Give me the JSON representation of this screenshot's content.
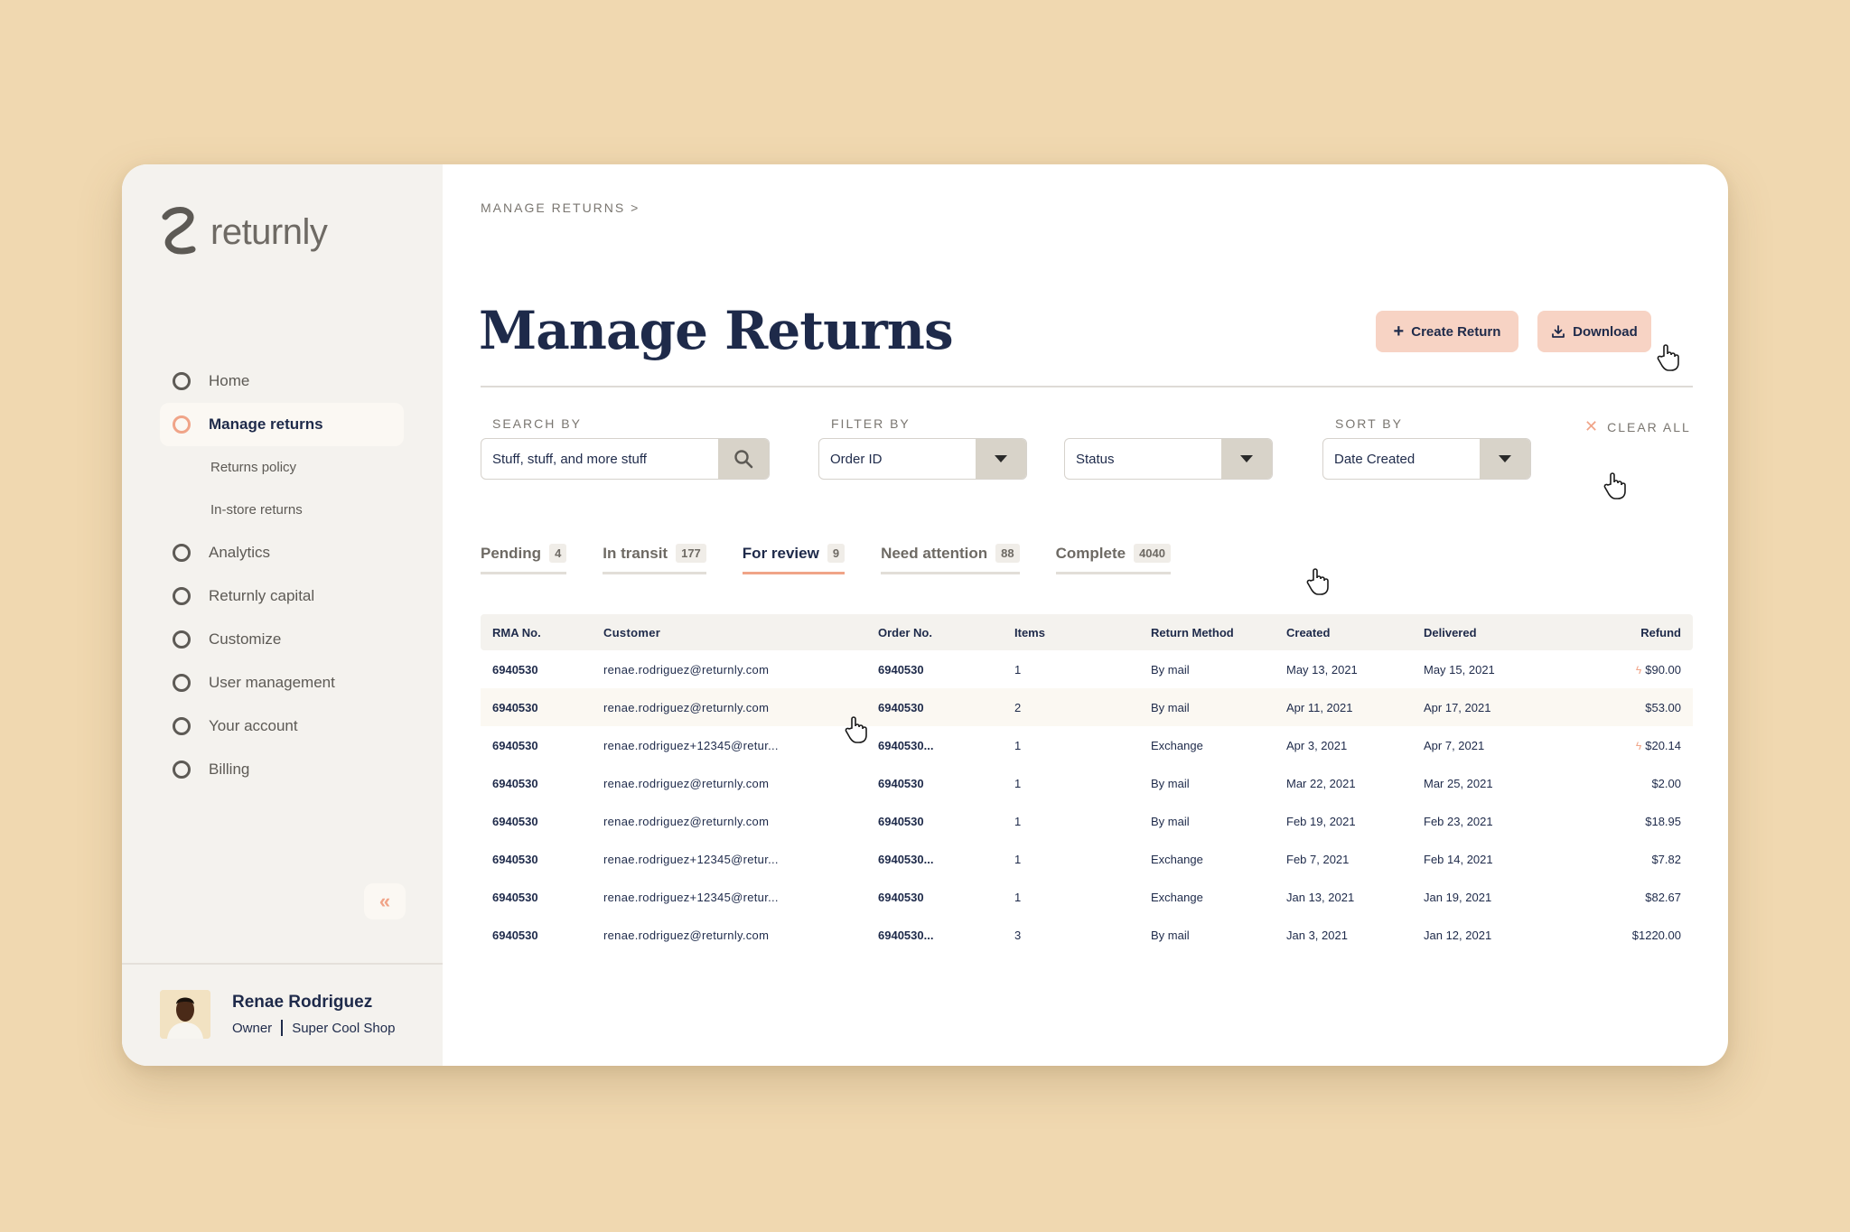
{
  "brand": {
    "name": "returnly",
    "accent": "#f0a488",
    "navy": "#1e2a4a"
  },
  "sidebar": {
    "nav": [
      {
        "label": "Home",
        "active": false
      },
      {
        "label": "Manage returns",
        "active": true
      },
      {
        "label": "Returns policy",
        "sub": true
      },
      {
        "label": "In-store returns",
        "sub": true
      },
      {
        "label": "Analytics",
        "active": false
      },
      {
        "label": "Returnly capital",
        "active": false
      },
      {
        "label": "Customize",
        "active": false
      },
      {
        "label": "User management",
        "active": false
      },
      {
        "label": "Your account",
        "active": false
      },
      {
        "label": "Billing",
        "active": false
      }
    ],
    "collapse_icon": "double-chevron-left-icon",
    "user": {
      "name": "Renae Rodriguez",
      "role": "Owner",
      "shop": "Super Cool Shop"
    }
  },
  "main": {
    "breadcrumb": "MANAGE RETURNS >",
    "title": "Manage Returns",
    "create_label": "Create Return",
    "download_label": "Download",
    "filters": {
      "search_label": "SEARCH BY",
      "search_value": "Stuff, stuff, and more stuff",
      "filter_label": "FILTER BY",
      "filter1_value": "Order ID",
      "filter2_value": "Status",
      "sort_label": "SORT BY",
      "sort_value": "Date Created",
      "clear_label": "CLEAR ALL"
    },
    "tabs": [
      {
        "label": "Pending",
        "count": "4"
      },
      {
        "label": "In transit",
        "count": "177"
      },
      {
        "label": "For review",
        "count": "9"
      },
      {
        "label": "Need attention",
        "count": "88"
      },
      {
        "label": "Complete",
        "count": "4040"
      }
    ],
    "table": {
      "headers": [
        "RMA No.",
        "Customer",
        "Order No.",
        "Items",
        "Return Method",
        "Created",
        "Delivered",
        "Refund"
      ],
      "rows": [
        [
          "6940530",
          "renae.rodriguez@returnly.com",
          "6940530",
          "1",
          "By mail",
          "May 13, 2021",
          "May 15, 2021",
          "$90.00"
        ],
        [
          "6940530",
          "renae.rodriguez@returnly.com",
          "6940530",
          "2",
          "By mail",
          "Apr 11, 2021",
          "Apr 17, 2021",
          "$53.00"
        ],
        [
          "6940530",
          "renae.rodriguez+12345@retur...",
          "6940530...",
          "1",
          "Exchange",
          "Apr 3, 2021",
          "Apr 7, 2021",
          "$20.14"
        ],
        [
          "6940530",
          "renae.rodriguez@returnly.com",
          "6940530",
          "1",
          "By mail",
          "Mar 22, 2021",
          "Mar 25, 2021",
          "$2.00"
        ],
        [
          "6940530",
          "renae.rodriguez@returnly.com",
          "6940530",
          "1",
          "By mail",
          "Feb 19, 2021",
          "Feb 23, 2021",
          "$18.95"
        ],
        [
          "6940530",
          "renae.rodriguez+12345@retur...",
          "6940530...",
          "1",
          "Exchange",
          "Feb 7, 2021",
          "Feb 14, 2021",
          "$7.82"
        ],
        [
          "6940530",
          "renae.rodriguez+12345@retur...",
          "6940530",
          "1",
          "Exchange",
          "Jan 13, 2021",
          "Jan 19, 2021",
          "$82.67"
        ],
        [
          "6940530",
          "renae.rodriguez@returnly.com",
          "6940530...",
          "3",
          "By mail",
          "Jan 3, 2021",
          "Jan 12, 2021",
          "$1220.00"
        ]
      ],
      "bolt_rows": [
        0,
        2
      ]
    }
  }
}
